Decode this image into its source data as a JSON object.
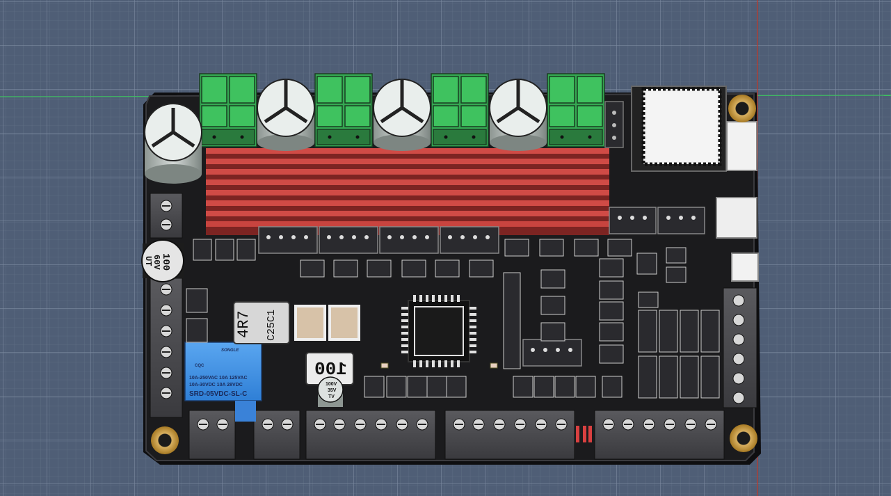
{
  "canvas": {
    "background": "#4f5e76",
    "grid_color": "#6c7a90",
    "axis_red": "#c0392b",
    "axis_green": "#2ecc71"
  },
  "board": {
    "pcb_color": "#1b1b1d",
    "edge_color": "#2b2b2f",
    "heatsink_color": "#c9433f",
    "terminal_green": "#35a852",
    "mount_hole_color": "#c89a3c"
  },
  "components": {
    "inductor": {
      "line1": "4R7",
      "line2": "C25C1"
    },
    "smd_resistor": {
      "label": "100"
    },
    "cap_left": {
      "line1": "100",
      "line2": "60V",
      "line3": "UT"
    },
    "cap_small": {
      "line1": "100V",
      "line2": "35V",
      "line3": "TV"
    },
    "relay": {
      "brand": "SONGLE",
      "cert": "CQC",
      "line1": "10A-250VAC 10A 125VAC",
      "line2": "10A-30VDC  10A 28VDC",
      "model": "SRD-05VDC-SL-C",
      "color": "#3d8fe0"
    }
  }
}
